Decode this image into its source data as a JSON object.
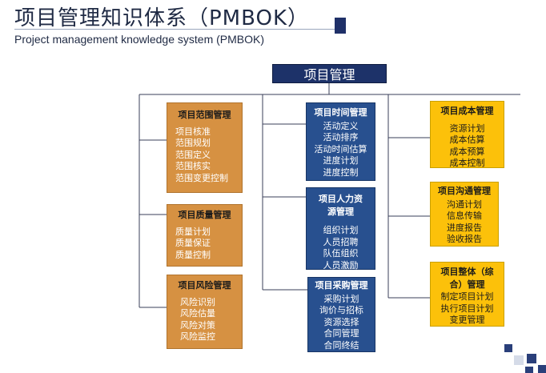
{
  "header": {
    "title": "项目管理知识体系（PMBOK）",
    "subtitle": "Project management knowledge system (PMBOK)"
  },
  "root": {
    "label": "项目管理"
  },
  "areas": {
    "scope": {
      "title": "项目范围管理",
      "items": [
        "项目核准",
        "范围规划",
        "范围定义",
        "范围核实",
        "范围变更控制"
      ]
    },
    "quality": {
      "title": "项目质量管理",
      "items": [
        "质量计划",
        "质量保证",
        "质量控制"
      ]
    },
    "risk": {
      "title": "项目风险管理",
      "items": [
        "风险识别",
        "风险估量",
        "风险对策",
        "风险监控"
      ]
    },
    "time": {
      "title": "项目时间管理",
      "items": [
        "活动定义",
        "活动排序",
        "活动时间估算",
        "进度计划",
        "进度控制"
      ]
    },
    "hr": {
      "title": "项目人力资源管理",
      "items": [
        "组织计划",
        "人员招聘",
        "队伍组织",
        "人员激励"
      ]
    },
    "procurement": {
      "title": "项目采购管理",
      "items": [
        "采购计划",
        "询价与招标",
        "资源选择",
        "合同管理",
        "合同终结"
      ]
    },
    "cost": {
      "title": "项目成本管理",
      "items": [
        "资源计划",
        "成本估算",
        "成本预算",
        "成本控制"
      ]
    },
    "communication": {
      "title": "项目沟通管理",
      "items": [
        "沟通计划",
        "信息传输",
        "进度报告",
        "验收报告"
      ]
    },
    "integration": {
      "title": "项目整体（综合）管理",
      "items": [
        "制定项目计划",
        "执行项目计划",
        "变更管理"
      ]
    }
  },
  "colors": {
    "navy": "#28508f",
    "orange": "#d69142",
    "yellow": "#fcc10a",
    "title_navy": "#1d3269"
  }
}
